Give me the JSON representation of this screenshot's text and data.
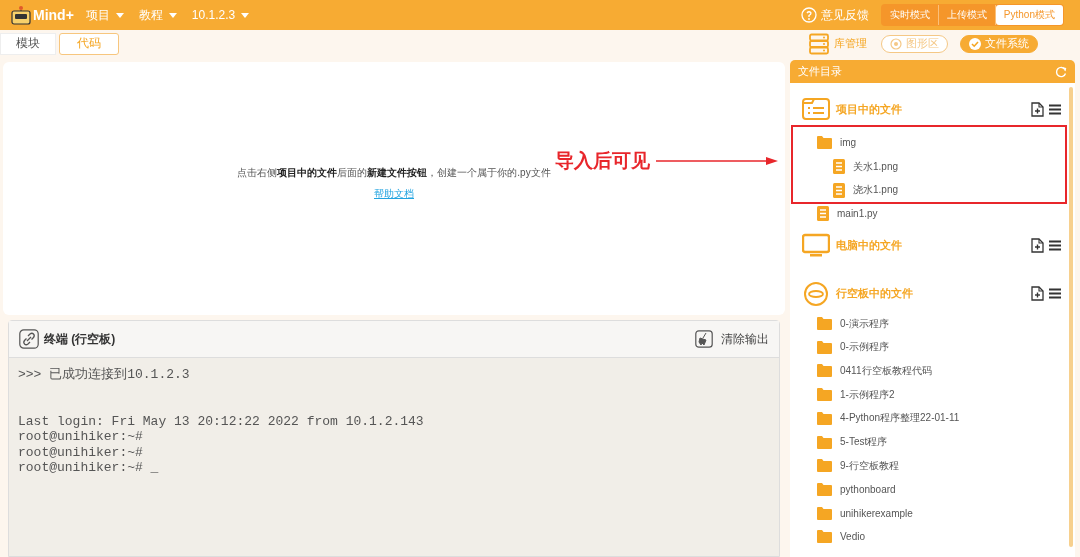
{
  "top_bar": {
    "app_name": "Mind+",
    "menus": [
      {
        "label": "项目"
      },
      {
        "label": "教程"
      },
      {
        "label": "10.1.2.3"
      }
    ],
    "feedback": "意见反馈",
    "modes": [
      {
        "label": "实时模式",
        "selected": false
      },
      {
        "label": "上传模式",
        "selected": false
      },
      {
        "label": "Python模式",
        "selected": true
      }
    ]
  },
  "sub_bar": {
    "tabs": [
      {
        "label": "模块",
        "selected": false
      },
      {
        "label": "代码",
        "selected": true
      }
    ],
    "library": "库管理",
    "views": [
      {
        "label": "图形区",
        "selected": false
      },
      {
        "label": "文件系统",
        "selected": true
      }
    ]
  },
  "editor": {
    "hint": "点击右侧**项目中的文件**后面的**新建文件按钮**，创建一个属于你的.py文件",
    "help_link": "帮助文档"
  },
  "annotation": {
    "text": "导入后可见"
  },
  "terminal": {
    "title": "终端 (行空板)",
    "clear_button": "清除输出",
    "blocks": [
      {
        "lines": [
          ">>> 已成功连接到10.1.2.3"
        ]
      },
      {
        "lines": [
          "Last login: Fri May 13 20:12:22 2022 from 10.1.2.143",
          "root@unihiker:~#",
          "root@unihiker:~#",
          "root@unihiker:~# _"
        ]
      }
    ]
  },
  "file_panel": {
    "title": "文件目录",
    "sections": [
      {
        "title": "项目中的文件",
        "items": [
          {
            "name": "img",
            "kind": "folder",
            "highlighted": true,
            "children": [
              {
                "name": "关水1.png",
                "kind": "file"
              },
              {
                "name": "浇水1.png",
                "kind": "file"
              }
            ]
          },
          {
            "name": "main1.py",
            "kind": "file"
          }
        ]
      },
      {
        "title": "电脑中的文件"
      },
      {
        "title": "行空板中的文件",
        "items": [
          {
            "name": "0-演示程序",
            "kind": "folder"
          },
          {
            "name": "0-示例程序",
            "kind": "folder"
          },
          {
            "name": "0411行空板教程代码",
            "kind": "folder"
          },
          {
            "name": "1-示例程序2",
            "kind": "folder"
          },
          {
            "name": "4-Python程序整理22-01-11",
            "kind": "folder"
          },
          {
            "name": "5-Test程序",
            "kind": "folder"
          },
          {
            "name": "9-行空板教程",
            "kind": "folder"
          },
          {
            "name": "pythonboard",
            "kind": "folder"
          },
          {
            "name": "unihikerexample",
            "kind": "folder"
          },
          {
            "name": "Vedio",
            "kind": "folder"
          }
        ]
      }
    ]
  }
}
